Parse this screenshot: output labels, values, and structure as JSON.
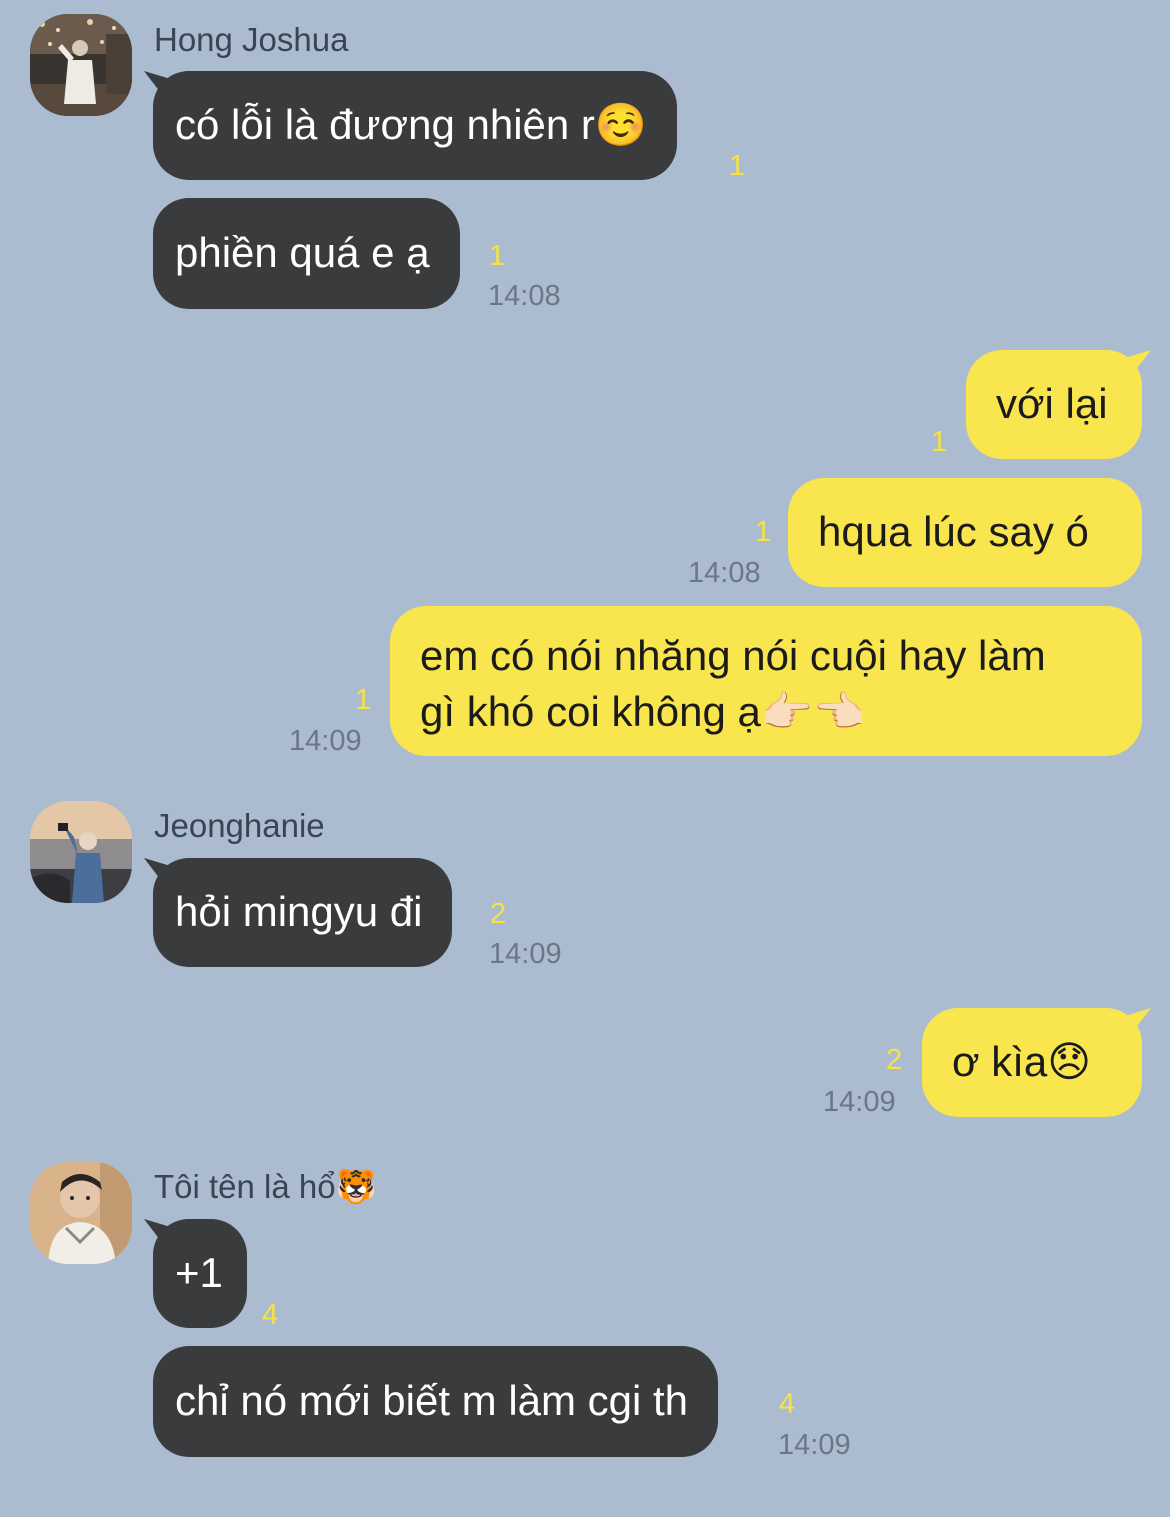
{
  "messages": {
    "m1": {
      "sender": "Hong Joshua",
      "text": "có lỗi là đương nhiên r☺️",
      "unread": "1"
    },
    "m2": {
      "text": "phiền quá e ạ",
      "unread": "1",
      "time": "14:08"
    },
    "m3": {
      "text": "với lại",
      "unread": "1"
    },
    "m4": {
      "text": "hqua lúc say ó",
      "unread": "1",
      "time": "14:08"
    },
    "m5": {
      "line1": "em có nói nhăng nói cuội hay làm",
      "line2": "gì khó coi không ạ👉🏻👈🏻",
      "unread": "1",
      "time": "14:09"
    },
    "m6": {
      "sender": "Jeonghanie",
      "text": "hỏi mingyu đi",
      "unread": "2",
      "time": "14:09"
    },
    "m7": {
      "text": "ơ kìa😞",
      "unread": "2",
      "time": "14:09"
    },
    "m8": {
      "sender": "Tôi tên là hổ🐯",
      "text": "+1",
      "unread": "4"
    },
    "m9": {
      "text": "chỉ nó mới biết m làm cgi th",
      "unread": "4",
      "time": "14:09"
    }
  },
  "colors": {
    "background": "#abbcd0",
    "incoming_bubble": "#3a3b3d",
    "outgoing_bubble": "#f9e54d",
    "unread_count": "#f7e240"
  }
}
